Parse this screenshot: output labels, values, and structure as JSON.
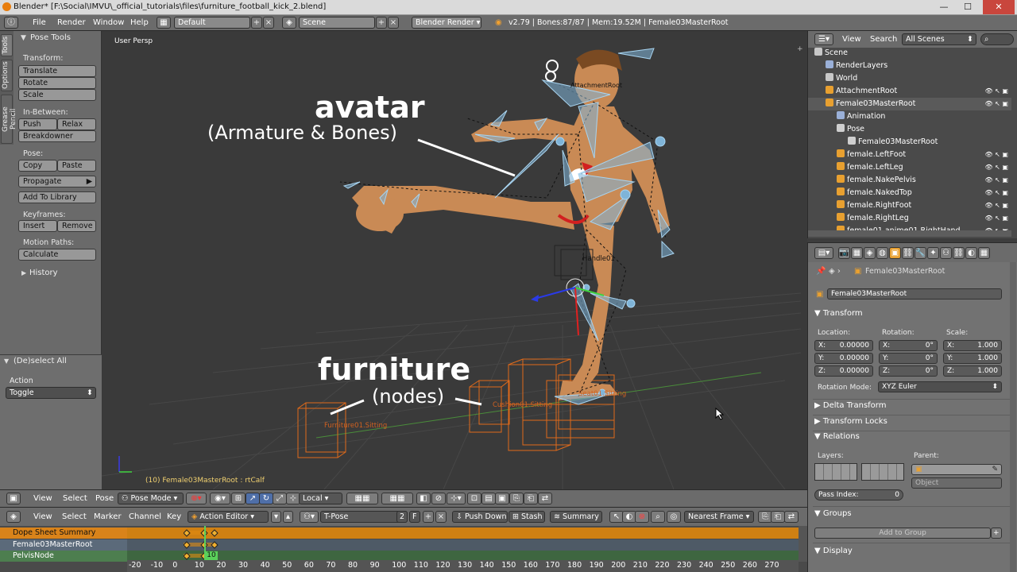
{
  "window": {
    "title": "Blender* [F:\\Social\\IMVU\\_official_tutorials\\files\\furniture_football_kick_2.blend]",
    "minimize": "—",
    "maximize": "☐",
    "close": "✕"
  },
  "info_header": {
    "menus": [
      "File",
      "Render",
      "Window",
      "Help"
    ],
    "layout": "Default",
    "scene": "Scene",
    "engine": "Blender Render",
    "stats": "v2.79 | Bones:87/87 | Mem:19.52M | Female03MasterRoot"
  },
  "toolshelf": {
    "tabs": [
      "Tools",
      "Options",
      "Grease Pencil"
    ],
    "panel_title": "Pose Tools",
    "transform_label": "Transform:",
    "translate": "Translate",
    "rotate": "Rotate",
    "scale": "Scale",
    "inbetween_label": "In-Between:",
    "push": "Push",
    "relax": "Relax",
    "breakdowner": "Breakdowner",
    "pose_label": "Pose:",
    "copy": "Copy",
    "paste": "Paste",
    "propagate": "Propagate",
    "add_to_library": "Add To Library",
    "keyframes_label": "Keyframes:",
    "insert": "Insert",
    "remove": "Remove",
    "motion_paths_label": "Motion Paths:",
    "calculate": "Calculate",
    "history": "History",
    "redo_title": "(De)select All",
    "action_label": "Action",
    "action_value": "Toggle"
  },
  "viewport": {
    "view_name": "User Persp",
    "status": "(10) Female03MasterRoot : rtCalf",
    "annot_avatar": "avatar",
    "annot_avatar_sub": "(Armature & Bones)",
    "annot_furniture": "furniture",
    "annot_furniture_sub": "(nodes)",
    "label_attachment": "AttachmentRoot",
    "label_handle": "Handle01",
    "label_seat1": "Furniture01.Sitting",
    "label_seat2": "Cushion01.Sitting",
    "label_seat3": "Seat01.Sitting"
  },
  "view3d_header": {
    "menus": [
      "View",
      "Select",
      "Pose"
    ],
    "mode": "Pose Mode",
    "orientation": "Local"
  },
  "dopesheet": {
    "menus": [
      "View",
      "Select",
      "Marker",
      "Channel",
      "Key"
    ],
    "editor": "Action Editor",
    "action": "T-Pose",
    "users": "2",
    "fake": "F",
    "push_down": "Push Down",
    "stash": "Stash",
    "summary": "Summary",
    "snap": "Nearest Frame",
    "channels": [
      "Dope Sheet Summary",
      "Female03MasterRoot",
      "PelvisNode"
    ],
    "current_frame": "10",
    "ruler": [
      "-20",
      "-10",
      "0",
      "10",
      "20",
      "30",
      "40",
      "50",
      "60",
      "70",
      "80",
      "90",
      "100",
      "110",
      "120",
      "130",
      "140",
      "150",
      "160",
      "170",
      "180",
      "190",
      "200",
      "210",
      "220",
      "230",
      "240",
      "250",
      "260",
      "270"
    ]
  },
  "outliner": {
    "menus": [
      "View",
      "Search"
    ],
    "filter": "All Scenes",
    "items": [
      "Scene",
      "RenderLayers",
      "World",
      "AttachmentRoot",
      "Female03MasterRoot",
      "Animation",
      "Pose",
      "Female03MasterRoot",
      "female.LeftFoot",
      "female.LeftLeg",
      "female.NakePelvis",
      "female.NakedTop",
      "female.RightFoot",
      "female.RightLeg",
      "female01.anime01.RightHand"
    ]
  },
  "properties": {
    "context": "Female03MasterRoot",
    "object_name": "Female03MasterRoot",
    "transform": "Transform",
    "location": "Location:",
    "rotation": "Rotation:",
    "scale": "Scale:",
    "loc": [
      "0.00000",
      "0.00000",
      "0.00000"
    ],
    "rot": [
      "0°",
      "0°",
      "0°"
    ],
    "scl": [
      "1.000",
      "1.000",
      "1.000"
    ],
    "axes": [
      "X:",
      "Y:",
      "Z:"
    ],
    "rotation_mode_label": "Rotation Mode:",
    "rotation_mode": "XYZ Euler",
    "delta_transform": "Delta Transform",
    "transform_locks": "Transform Locks",
    "relations": "Relations",
    "layers": "Layers:",
    "parent": "Parent:",
    "parent_type": "Object",
    "pass_index": "Pass Index:",
    "pass_index_value": "0",
    "groups": "Groups",
    "add_to_group": "Add to Group",
    "display": "Display"
  },
  "colors": {
    "accent": "#e87d0d",
    "bone": "#7fb4d8",
    "selected_bone": "#a8d4f0",
    "furniture": "#e06a1a",
    "skin": "#c98a55"
  }
}
